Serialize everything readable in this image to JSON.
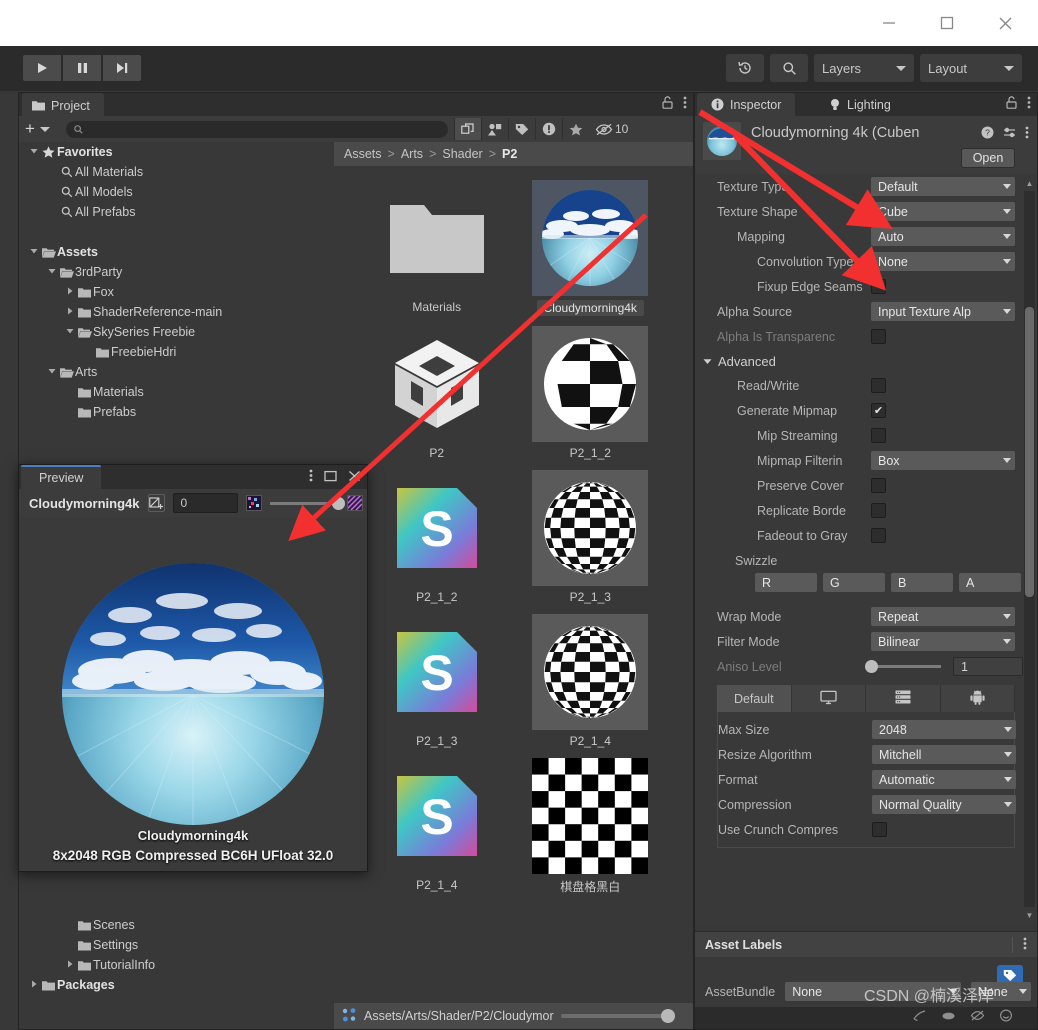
{
  "window": {
    "controls": [
      {
        "name": "minimize",
        "glyph": "—"
      },
      {
        "name": "maximize",
        "glyph": "☐"
      },
      {
        "name": "close",
        "glyph": "✕"
      }
    ]
  },
  "toolbar": {
    "play": "▶",
    "pause": "⏸",
    "step": "⏭",
    "history_icon": "undo-history-icon",
    "search_icon": "search-icon",
    "layers_label": "Layers",
    "layout_label": "Layout"
  },
  "project": {
    "tab_label": "Project",
    "add_label": "+",
    "search_placeholder": "",
    "search_value": "",
    "filter_icons": [
      "window-icon",
      "asset-type-icon",
      "label-icon",
      "warning-icon",
      "favorite-star-icon"
    ],
    "hidden_count": "10",
    "tree": [
      {
        "label": "Favorites",
        "depth": 0,
        "arrow": "down",
        "icon": "star",
        "bold": true
      },
      {
        "label": "All Materials",
        "depth": 1,
        "arrow": "none",
        "icon": "search",
        "bold": false
      },
      {
        "label": "All Models",
        "depth": 1,
        "arrow": "none",
        "icon": "search",
        "bold": false
      },
      {
        "label": "All Prefabs",
        "depth": 1,
        "arrow": "none",
        "icon": "search",
        "bold": false
      },
      {
        "label": "",
        "depth": 0,
        "arrow": "none",
        "icon": "none",
        "bold": false
      },
      {
        "label": "Assets",
        "depth": 0,
        "arrow": "down",
        "icon": "folder-open",
        "bold": true
      },
      {
        "label": "3rdParty",
        "depth": 1,
        "arrow": "down",
        "icon": "folder-open",
        "bold": false
      },
      {
        "label": "Fox",
        "depth": 2,
        "arrow": "right",
        "icon": "folder",
        "bold": false
      },
      {
        "label": "ShaderReference-main",
        "depth": 2,
        "arrow": "right",
        "icon": "folder",
        "bold": false
      },
      {
        "label": "SkySeries Freebie",
        "depth": 2,
        "arrow": "down",
        "icon": "folder-open",
        "bold": false
      },
      {
        "label": "FreebieHdri",
        "depth": 3,
        "arrow": "none",
        "icon": "folder",
        "bold": false
      },
      {
        "label": "Arts",
        "depth": 1,
        "arrow": "down",
        "icon": "folder-open",
        "bold": false
      },
      {
        "label": "Materials",
        "depth": 2,
        "arrow": "none",
        "icon": "folder",
        "bold": false
      },
      {
        "label": "Prefabs",
        "depth": 2,
        "arrow": "none",
        "icon": "folder",
        "bold": false
      }
    ],
    "tree_bottom": [
      {
        "label": "Scenes",
        "depth": 2,
        "arrow": "none",
        "icon": "folder",
        "bold": false
      },
      {
        "label": "Settings",
        "depth": 2,
        "arrow": "none",
        "icon": "folder",
        "bold": false
      },
      {
        "label": "TutorialInfo",
        "depth": 2,
        "arrow": "right",
        "icon": "folder",
        "bold": false
      },
      {
        "label": "Packages",
        "depth": 0,
        "arrow": "right",
        "icon": "folder",
        "bold": true
      }
    ],
    "breadcrumb": [
      "Assets",
      "Arts",
      "Shader",
      "P2"
    ],
    "status_path": "Assets/Arts/Shader/P2/Cloudymor",
    "assets": [
      {
        "label": "Materials",
        "kind": "folder",
        "selected": false
      },
      {
        "label": "Cloudymorning4k",
        "kind": "cubemap-sky",
        "selected": true
      },
      {
        "label": "P2",
        "kind": "unity-cube",
        "selected": false
      },
      {
        "label": "P2_1_2",
        "kind": "checker-sphere-coarse",
        "selected": false
      },
      {
        "label": "P2_1_2",
        "kind": "shader-s",
        "selected": false
      },
      {
        "label": "P2_1_3",
        "kind": "checker-sphere-fine",
        "selected": false
      },
      {
        "label": "P2_1_3",
        "kind": "shader-s",
        "selected": false
      },
      {
        "label": "P2_1_4",
        "kind": "checker-sphere-fine",
        "selected": false
      },
      {
        "label": "P2_1_4",
        "kind": "shader-s",
        "selected": false
      },
      {
        "label": "棋盘格黑白",
        "kind": "checker-flat",
        "selected": false
      }
    ]
  },
  "preview": {
    "tab_label": "Preview",
    "asset_name": "Cloudymorning4k",
    "mip_value": "0",
    "caption_name": "Cloudymorning4k",
    "caption_info": "8x2048  RGB Compressed BC6H UFloat   32.0",
    "window_buttons": [
      "menu-kebab-icon",
      "maximize-icon",
      "close-icon"
    ]
  },
  "inspector": {
    "tab_label": "Inspector",
    "tab2_label": "Lighting",
    "asset_title": "Cloudymorning 4k (Cuben",
    "open_button": "Open",
    "properties": [
      {
        "label": "Texture Type",
        "type": "dropdown",
        "value": "Default",
        "indent": 0,
        "dim": false
      },
      {
        "label": "Texture Shape",
        "type": "dropdown",
        "value": "Cube",
        "indent": 0,
        "dim": false
      },
      {
        "label": "Mapping",
        "type": "dropdown",
        "value": "Auto",
        "indent": 1,
        "dim": false
      },
      {
        "label": "Convolution Type",
        "type": "dropdown",
        "value": "None",
        "indent": 2,
        "dim": false
      },
      {
        "label": "Fixup Edge Seams",
        "type": "checkbox",
        "value": false,
        "indent": 2,
        "dim": false
      },
      {
        "label": "Alpha Source",
        "type": "dropdown",
        "value": "Input Texture Alp",
        "indent": 0,
        "dim": false
      },
      {
        "label": "Alpha Is Transparenc",
        "type": "checkbox",
        "value": false,
        "indent": 0,
        "dim": true
      },
      {
        "label": "Advanced",
        "type": "foldout",
        "value": "",
        "indent": 0,
        "dim": false
      },
      {
        "label": "Read/Write",
        "type": "checkbox",
        "value": false,
        "indent": 1,
        "dim": false
      },
      {
        "label": "Generate Mipmap",
        "type": "checkbox",
        "value": true,
        "indent": 1,
        "dim": false
      },
      {
        "label": "Mip Streaming",
        "type": "checkbox",
        "value": false,
        "indent": 2,
        "dim": false
      },
      {
        "label": "Mipmap Filterin",
        "type": "dropdown",
        "value": "Box",
        "indent": 2,
        "dim": false
      },
      {
        "label": "Preserve Cover",
        "type": "checkbox",
        "value": false,
        "indent": 2,
        "dim": false
      },
      {
        "label": "Replicate Borde",
        "type": "checkbox",
        "value": false,
        "indent": 2,
        "dim": false
      },
      {
        "label": "Fadeout to Gray",
        "type": "checkbox",
        "value": false,
        "indent": 2,
        "dim": false
      },
      {
        "label": "Swizzle",
        "type": "header",
        "value": "",
        "indent": 1,
        "dim": false
      }
    ],
    "swizzle": [
      "R",
      "G",
      "B",
      "A"
    ],
    "wrap_mode": {
      "label": "Wrap Mode",
      "value": "Repeat"
    },
    "filter_mode": {
      "label": "Filter Mode",
      "value": "Bilinear"
    },
    "aniso": {
      "label": "Aniso Level",
      "value": "1"
    },
    "platform_tabs": [
      {
        "label": "Default",
        "icon": "text",
        "active": true
      },
      {
        "label": "",
        "icon": "monitor-icon",
        "active": false
      },
      {
        "label": "",
        "icon": "server-icon",
        "active": false
      },
      {
        "label": "",
        "icon": "android-icon",
        "active": false
      }
    ],
    "platform_settings": [
      {
        "label": "Max Size",
        "value": "2048"
      },
      {
        "label": "Resize Algorithm",
        "value": "Mitchell"
      },
      {
        "label": "Format",
        "value": "Automatic"
      },
      {
        "label": "Compression",
        "value": "Normal Quality"
      }
    ],
    "crunch": {
      "label": "Use Crunch Compres",
      "value": false
    },
    "asset_labels_title": "Asset Labels",
    "asset_bundle": {
      "label": "AssetBundle",
      "value": "None",
      "variant": "None"
    }
  },
  "watermark": "CSDN @楠溪泽岸",
  "colors": {
    "editor_bg": "#383838",
    "panel_bg": "#3c3c3c",
    "toolbar_bg": "#2b2b2b",
    "dropdown_bg": "#5a5a5a",
    "accent_blue": "#4b7dc0",
    "tag_blue": "#2f6cb5",
    "arrow_red": "#f23030",
    "text": "#c9c9c9"
  }
}
